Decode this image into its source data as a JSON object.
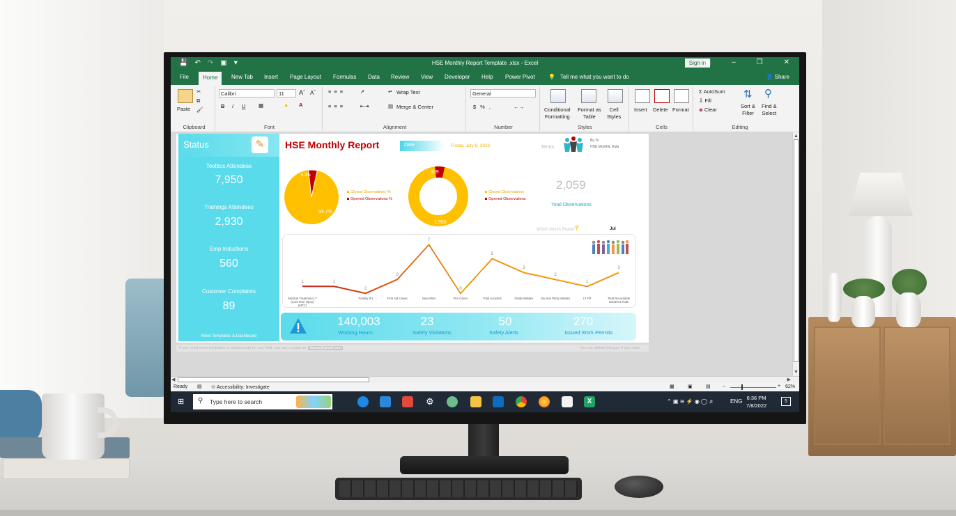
{
  "window": {
    "title": "HSE Monthly Report Template .xlsx  -  Excel",
    "sign_in": "Sign in",
    "share": "Share"
  },
  "tabs": [
    "File",
    "Home",
    "New Tab",
    "Insert",
    "Page Layout",
    "Formulas",
    "Data",
    "Review",
    "View",
    "Developer",
    "Help",
    "Power Pivot"
  ],
  "tell_me": "Tell me what you want to do",
  "ribbon": {
    "paste": "Paste",
    "clipboard": "Clipboard",
    "font_name": "Calibri",
    "font_size": "11",
    "font": "Font",
    "wrap_text": "Wrap Text",
    "merge_center": "Merge & Center",
    "alignment": "Alignment",
    "number_format": "General",
    "number": "Number",
    "conditional": "Conditional",
    "conditional2": "Formatting",
    "format_as": "Format as",
    "format_as2": "Table",
    "cell": "Cell",
    "cell2": "Styles",
    "styles": "Styles",
    "insert": "Insert",
    "delete": "Delete",
    "format": "Format",
    "cells": "Cells",
    "autosum": "AutoSum",
    "fill": "Fill",
    "clear": "Clear",
    "sort_filter": "Sort &",
    "sort_filter2": "Filter",
    "find_select": "Find &",
    "find_select2": "Select",
    "editing": "Editing"
  },
  "dashboard": {
    "status_title": "Status",
    "status": [
      {
        "label": "Toolbox Attendees",
        "value": "7,950"
      },
      {
        "label": "Trainings Attendees",
        "value": "2,930"
      },
      {
        "label": "Emp Inductions",
        "value": "560"
      },
      {
        "label": "Customer Complaints",
        "value": "89"
      }
    ],
    "status_footer": "More Templates & Dashboard",
    "title": "HSE Monthly Report",
    "date_label": "Date",
    "date_value": "Friday, July 8, 2022",
    "terms": "Terms",
    "by_to": "By To",
    "brand": "HSE Monthly Data",
    "pie1": {
      "slices": [
        {
          "label": "Closed Observations %",
          "value": 94.7,
          "color": "#ffc000"
        },
        {
          "label": "Opened Observations %",
          "value": 5.3,
          "color": "#c00000"
        }
      ],
      "big_label": "94.7%",
      "small_label": "5.3%"
    },
    "pie2": {
      "slices": [
        {
          "label": "Closed Observations",
          "value": 1950,
          "color": "#ffc000"
        },
        {
          "label": "Opened Observations",
          "value": 109,
          "color": "#c00000"
        }
      ],
      "big_label": "1,950",
      "small_label": "109"
    },
    "total_observations": "2,059",
    "total_observations_label": "Total Observations",
    "which_month": "Which Month Report",
    "month": "Jul",
    "kpis": [
      {
        "value": "140,003",
        "label": "Working Hours"
      },
      {
        "value": "23",
        "label": "Safety Violations"
      },
      {
        "value": "50",
        "label": "Safety Alerts"
      },
      {
        "value": "270",
        "label": "Issued Work Permits"
      }
    ],
    "footnote": "If you need more templates or dashboards for any field, you can contact us:",
    "email": "dtrzas@gmail.com",
    "footnote_right": "You can delete this part if you want."
  },
  "chart_data": {
    "type": "line",
    "categories": [
      "Medical Treatment LT (Lost Time Injury) (MTC)",
      "Fatality (F)",
      "First Aid Cases",
      "Near Miss",
      "Fire Cases",
      "Total Accident",
      "Divali Mistake",
      "Second Party Mistake",
      "LT FR",
      "Total Recordable Incidence Rate"
    ],
    "values": [
      1,
      1,
      0,
      2,
      7,
      0,
      5,
      3,
      2,
      1,
      3
    ],
    "display_categories": [
      "Medical Treatment LT (Lost Time Injury) (MTC)",
      "",
      "Fatality (F)",
      "First Aid Cases",
      "Near Miss",
      "Fire Cases",
      "Total Accident",
      "Divali Mistake",
      "Second Party Mistake",
      "LT FR",
      "Total Recordable Incidence Rate"
    ],
    "colors": [
      "#ffc000",
      "#c00000"
    ]
  },
  "statusbar": {
    "ready": "Ready",
    "accessibility": "Accessibility: Investigate",
    "zoom": "62%"
  },
  "taskbar": {
    "search_placeholder": "Type here to search",
    "lang": "ENG",
    "time": "6:36 PM",
    "date": "7/8/2022",
    "notifications": "5"
  }
}
